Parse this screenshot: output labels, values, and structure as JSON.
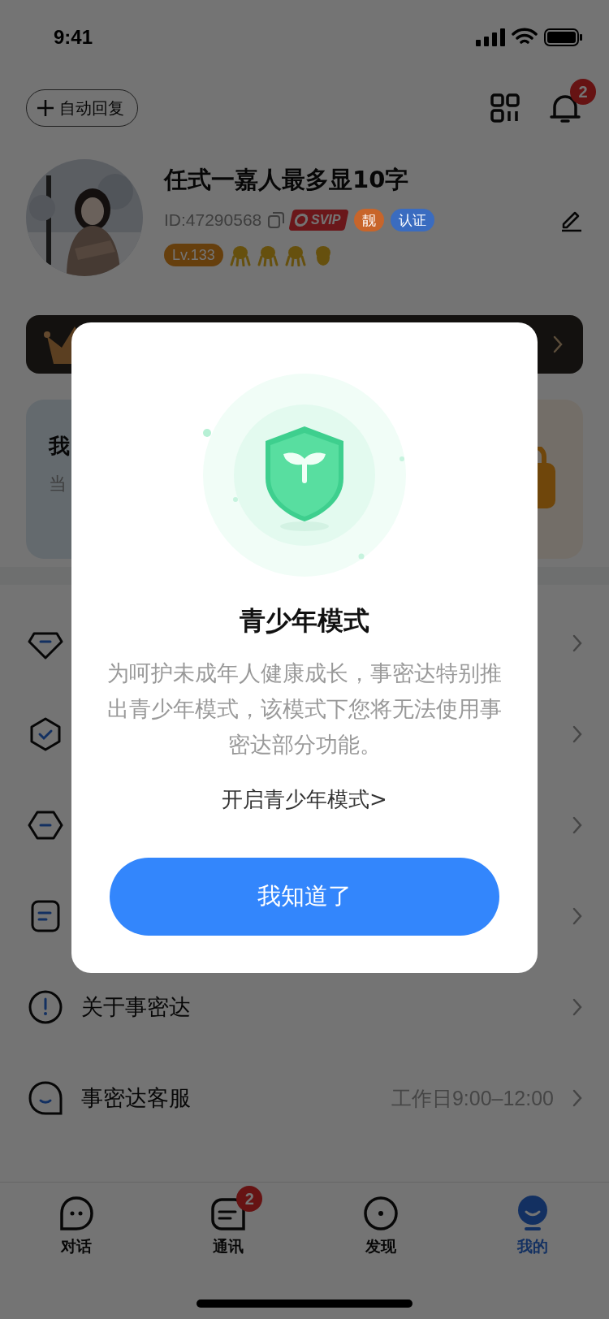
{
  "status_bar": {
    "time": "9:41"
  },
  "header": {
    "auto_reply": "自动回复",
    "notification_badge": "2"
  },
  "profile": {
    "name": "任式一嘉人最多显10字",
    "id": "ID:47290568",
    "level": "Lv.133",
    "badges": [
      {
        "kind": "svip",
        "label": "SVIP"
      },
      {
        "kind": "tag",
        "label": "靓",
        "color": "#c8652a"
      },
      {
        "kind": "tag",
        "label": "认证",
        "color": "#3a6cc0"
      }
    ]
  },
  "card": {
    "title": "我",
    "subtitle": "当"
  },
  "menu": [
    {
      "kind": "diamond"
    },
    {
      "kind": "shield"
    },
    {
      "kind": "hexagon"
    },
    {
      "kind": "note"
    },
    {
      "kind": "info",
      "label": "关于事密达"
    },
    {
      "kind": "service",
      "label": "事密达客服",
      "detail": "工作日9:00–12:00"
    }
  ],
  "tabs": [
    {
      "kind": "chat",
      "label": "对话",
      "selected": false
    },
    {
      "kind": "contacts",
      "label": "通讯",
      "selected": false,
      "badge": "2"
    },
    {
      "kind": "discover",
      "label": "发现",
      "selected": false
    },
    {
      "kind": "me",
      "label": "我的",
      "selected": true
    }
  ],
  "dialog": {
    "title": "青少年模式",
    "message": "为呵护未成年人健康成长，事密达特别推出青少年模式，该模式下您将无法使用事密达部分功能。",
    "link": "开启青少年模式>",
    "button": "我知道了"
  }
}
